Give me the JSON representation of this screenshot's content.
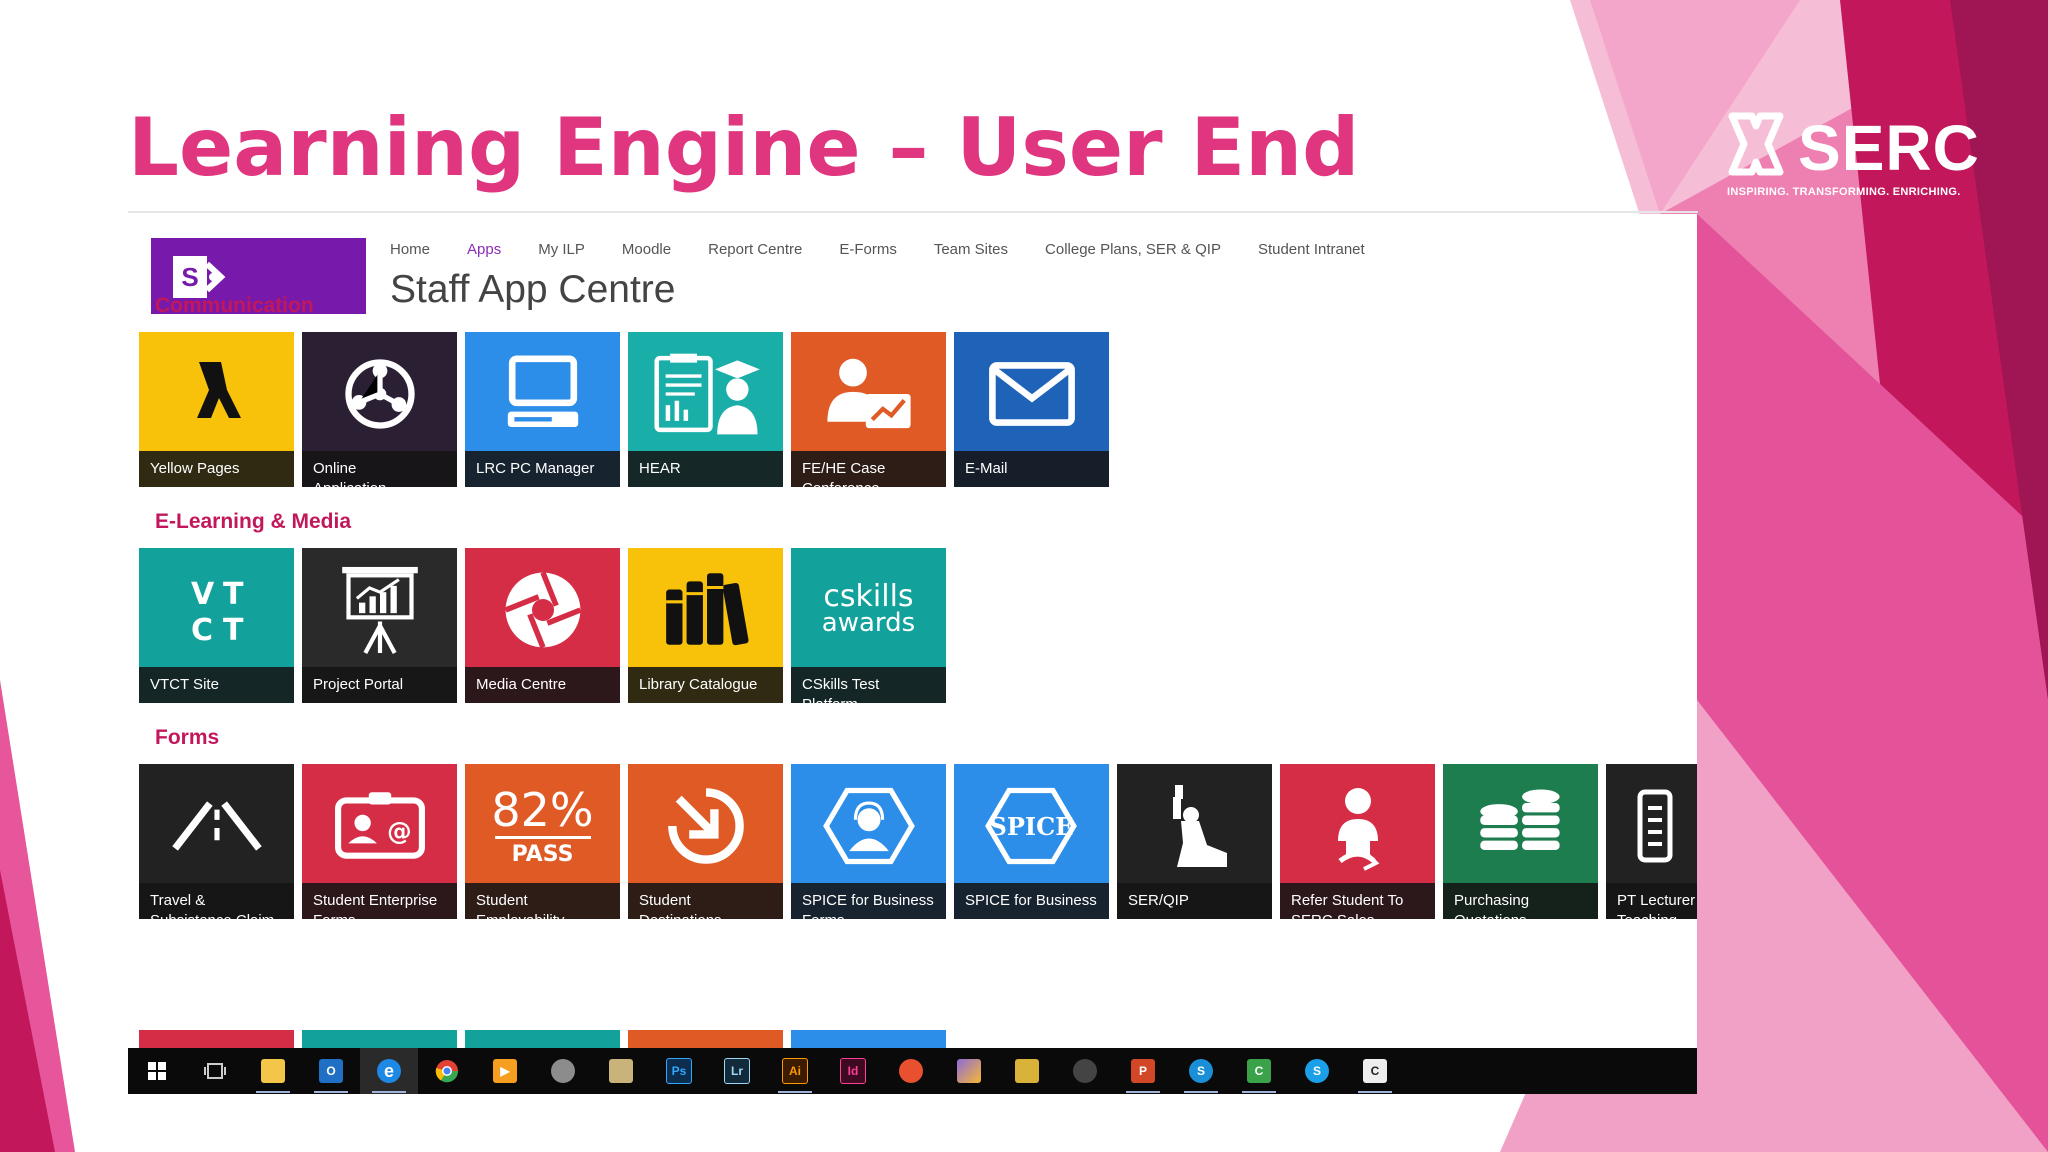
{
  "slide": {
    "title": "Learning Engine – User End",
    "logo_text": "SERC",
    "logo_tagline": "INSPIRING. TRANSFORMING. ENRICHING.",
    "accent_color": "#e0357f"
  },
  "site": {
    "nav": [
      "Home",
      "Apps",
      "My ILP",
      "Moodle",
      "Report Centre",
      "E-Forms",
      "Team Sites",
      "College Plans, SER & QIP",
      "Student Intranet"
    ],
    "active_nav": "Apps",
    "title": "Staff App Centre",
    "sections": [
      {
        "heading": "Communication",
        "tiles": [
          {
            "label": "Yellow Pages",
            "color": "#f8c20a",
            "icon": "walking-fingers-icon"
          },
          {
            "label": "Online Application…",
            "color": "#2a1f33",
            "icon": "network-globe-icon"
          },
          {
            "label": "LRC PC Manager",
            "color": "#2c8ee8",
            "icon": "computer-icon"
          },
          {
            "label": "HEAR",
            "color": "#1aaea8",
            "icon": "graduate-clipboard-icon"
          },
          {
            "label": "FE/HE Case Conference",
            "color": "#e05a26",
            "icon": "user-chart-icon"
          },
          {
            "label": "E-Mail",
            "color": "#1f63b8",
            "icon": "envelope-icon"
          }
        ]
      },
      {
        "heading": "E-Learning & Media",
        "tiles": [
          {
            "label": "VTCT Site",
            "color": "#12a29b",
            "icon": "vtct-logo-icon"
          },
          {
            "label": "Project Portal",
            "color": "#2a2a2a",
            "icon": "presentation-board-icon"
          },
          {
            "label": "Media Centre",
            "color": "#d62d47",
            "icon": "aperture-icon"
          },
          {
            "label": "Library Catalogue",
            "color": "#f8c20a",
            "icon": "books-icon"
          },
          {
            "label": "CSkills Test Platform",
            "color": "#12a29b",
            "icon": "cskills-logo-icon",
            "logo_line1": "cskills",
            "logo_line2": "awards"
          }
        ]
      },
      {
        "heading": "Forms",
        "tiles": [
          {
            "label": "Travel & Subsistence Claim",
            "color": "#222222",
            "icon": "road-icon"
          },
          {
            "label": "Student Enterprise Forms",
            "color": "#d62d47",
            "icon": "contact-card-icon"
          },
          {
            "label": "Student Employability",
            "color": "#e05a26",
            "icon": "pass-rate-icon",
            "big_text": "82%",
            "sub_text": "PASS"
          },
          {
            "label": "Student Destinations",
            "color": "#e05a26",
            "icon": "arrow-target-icon"
          },
          {
            "label": "SPICE for Business Forms",
            "color": "#2c8ee8",
            "icon": "headset-agent-icon"
          },
          {
            "label": "SPICE for Business",
            "color": "#2c8ee8",
            "icon": "spice-logo-icon",
            "logo_text": "SPICE"
          },
          {
            "label": "SER/QIP",
            "color": "#222222",
            "icon": "statue-of-liberty-icon"
          },
          {
            "label": "Refer Student To SERC Sales",
            "color": "#d62d47",
            "icon": "refer-person-icon"
          },
          {
            "label": "Purchasing Quotations",
            "color": "#1e7d4e",
            "icon": "coin-stacks-icon"
          },
          {
            "label": "PT Lecturer Teaching",
            "color": "#222222",
            "icon": "document-icon"
          }
        ]
      }
    ],
    "partial_row_colors": [
      "#d62d47",
      "#12a29b",
      "#12a29b",
      "#e05a26",
      "#2c8ee8"
    ]
  },
  "taskbar": {
    "icons": [
      {
        "name": "windows-start-icon",
        "glyph": "",
        "color": "#ffffff",
        "open": false
      },
      {
        "name": "task-view-icon",
        "glyph": "",
        "color": "#cccccc",
        "open": false
      },
      {
        "name": "file-explorer-icon",
        "glyph": "",
        "color": "#f3c64a",
        "open": true
      },
      {
        "name": "outlook-icon",
        "glyph": "O",
        "color": "#1f6fc5",
        "open": true
      },
      {
        "name": "edge-icon",
        "glyph": "e",
        "color": "#1e88e5",
        "open": true
      },
      {
        "name": "chrome-icon",
        "glyph": "",
        "color": "#e34133",
        "open": false
      },
      {
        "name": "media-player-icon",
        "glyph": "",
        "color": "#f59e1f",
        "open": false
      },
      {
        "name": "settings-tool-icon",
        "glyph": "",
        "color": "#8c8c8c",
        "open": false
      },
      {
        "name": "notepad-icon",
        "glyph": "",
        "color": "#c9b37a",
        "open": false
      },
      {
        "name": "photoshop-icon",
        "glyph": "Ps",
        "color": "#0c2d4d",
        "open": false
      },
      {
        "name": "lightroom-icon",
        "glyph": "Lr",
        "color": "#132a3a",
        "open": false
      },
      {
        "name": "illustrator-icon",
        "glyph": "Ai",
        "color": "#3b1c00",
        "open": true
      },
      {
        "name": "indesign-icon",
        "glyph": "Id",
        "color": "#3d0a22",
        "open": false
      },
      {
        "name": "swirl-app-icon",
        "glyph": "",
        "color": "#e8502f",
        "open": false
      },
      {
        "name": "photos-icon",
        "glyph": "",
        "color": "#8e6cd8",
        "open": false
      },
      {
        "name": "game-icon",
        "glyph": "",
        "color": "#d9b23a",
        "open": false
      },
      {
        "name": "obs-icon",
        "glyph": "",
        "color": "#444444",
        "open": false
      },
      {
        "name": "powerpoint-icon",
        "glyph": "P",
        "color": "#d24726",
        "open": true
      },
      {
        "name": "skype-business-icon",
        "glyph": "S",
        "color": "#1a8fd8",
        "open": true
      },
      {
        "name": "camtasia-icon",
        "glyph": "C",
        "color": "#3aa34a",
        "open": true
      },
      {
        "name": "skype-icon",
        "glyph": "S",
        "color": "#1a9fe8",
        "open": false
      },
      {
        "name": "camtasia-recorder-icon",
        "glyph": "C",
        "color": "#eeeeee",
        "open": true
      }
    ]
  }
}
